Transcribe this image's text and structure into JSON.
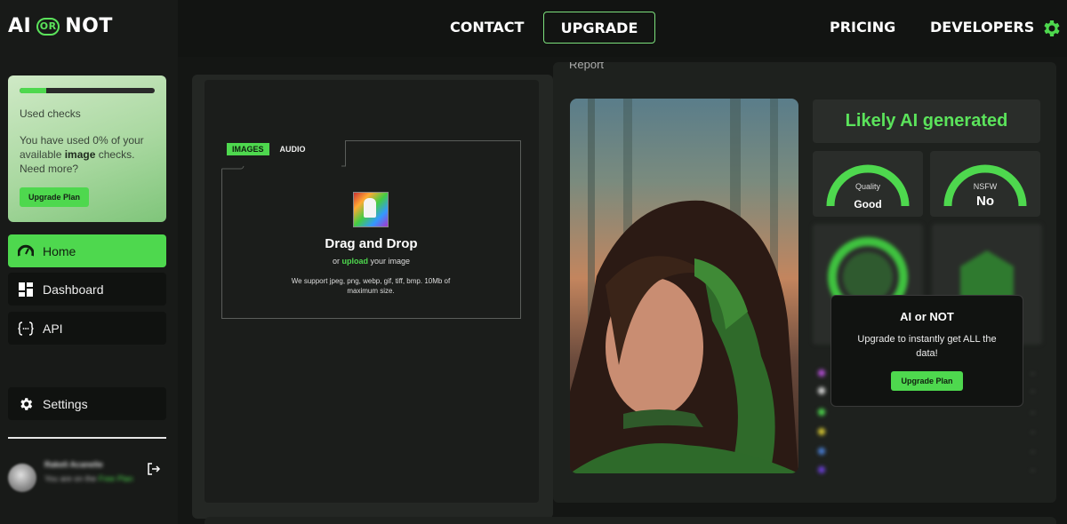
{
  "app": {
    "logo_left": "AI",
    "logo_or": "OR",
    "logo_right": "NOT"
  },
  "topnav": {
    "contact": "CONTACT",
    "upgrade": "UPGRADE",
    "pricing": "PRICING",
    "developers": "DEVELOPERS",
    "settings_icon": "gear-icon"
  },
  "usage": {
    "progress_fraction": 0.2,
    "title": "Used checks",
    "text_before": "You have used 0% of your available ",
    "text_bold": "image",
    "text_after": " checks. Need more?",
    "button": "Upgrade Plan"
  },
  "sidebar": {
    "items": [
      {
        "label": "Home",
        "icon": "speedometer-icon",
        "active": true
      },
      {
        "label": "Dashboard",
        "icon": "dashboard-icon",
        "active": false
      },
      {
        "label": "API",
        "icon": "code-braces-icon",
        "active": false
      },
      {
        "label": "Settings",
        "icon": "gear-icon",
        "active": false
      }
    ]
  },
  "user": {
    "name": "Rakeli Acanelie",
    "plan_prefix": "You are on the ",
    "plan_name": "Free Plan"
  },
  "uploader": {
    "tabs": [
      "IMAGES",
      "AUDIO"
    ],
    "title": "Drag and Drop",
    "sub_prefix": "or ",
    "sub_link": "upload",
    "sub_suffix": " your image",
    "support": "We support jpeg, png, webp, gif, tiff, bmp. 10Mb of maximum size."
  },
  "report": {
    "label": "Report",
    "verdict": "Likely AI generated",
    "quality_label": "Quality",
    "quality_value": "Good",
    "nsfw_label": "NSFW",
    "nsfw_value": "No",
    "colors": {
      "accent": "#4ed84e",
      "verdict": "#5be35b"
    }
  },
  "popup": {
    "title": "AI or NOT",
    "text": "Upgrade to instantly get ALL the data!",
    "button": "Upgrade Plan"
  }
}
